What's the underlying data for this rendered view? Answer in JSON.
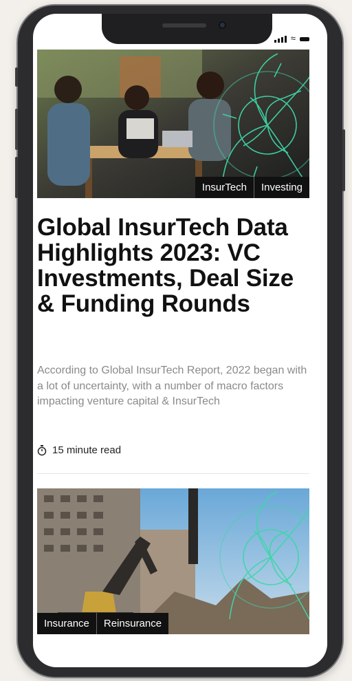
{
  "status_bar": {
    "signal_icon": "signal-bars-icon",
    "wifi_icon": "wifi-icon",
    "battery_icon": "battery-icon"
  },
  "articles": [
    {
      "tags": [
        "InsurTech",
        "Investing"
      ],
      "title": "Global InsurTech Data Highlights 2023: VC Investments, Deal Size & Funding Rounds",
      "description": "According to Global InsurTech Report, 2022 began with a lot of uncertainty, with a number of macro factors impacting venture capital & InsurTech",
      "read_time": "15 minute read",
      "read_time_icon": "stopwatch-icon"
    },
    {
      "tags": [
        "Insurance",
        "Reinsurance"
      ]
    }
  ],
  "colors": {
    "title": "#111111",
    "description": "#8a8a8a",
    "tag_bg": "#111111",
    "accent_lotus": "#3fd6a8"
  }
}
